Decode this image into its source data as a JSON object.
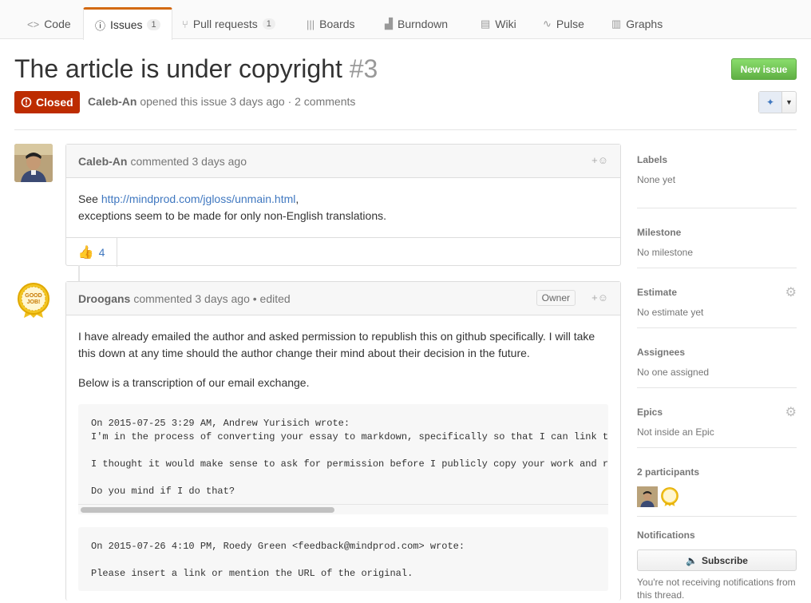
{
  "tabs": [
    {
      "icon": "<>",
      "label": "Code"
    },
    {
      "icon": "ⓘ",
      "label": "Issues",
      "count": "1"
    },
    {
      "icon": "⑂",
      "label": "Pull requests",
      "count": "1"
    },
    {
      "icon": "|||",
      "label": "Boards"
    },
    {
      "icon": "▟",
      "label": "Burndown"
    },
    {
      "icon": "▤",
      "label": "Wiki"
    },
    {
      "icon": "∿",
      "label": "Pulse"
    },
    {
      "icon": "▥",
      "label": "Graphs"
    }
  ],
  "issue": {
    "title": "The article is under copyright",
    "number": "#3",
    "state": "Closed",
    "author": "Caleb-An",
    "meta_rest": "opened this issue 3 days ago · 2 comments",
    "new_issue_label": "New issue"
  },
  "comments": [
    {
      "author": "Caleb-An",
      "action": "commented 3 days ago",
      "body_prefix": "See ",
      "link": "http://mindprod.com/jgloss/unmain.html",
      "body_suffix": ",",
      "body_line2": "exceptions seem to be made for only non-English translations.",
      "reaction_emoji": "👍",
      "reaction_count": "4",
      "react_icon": "+☺"
    },
    {
      "author": "Droogans",
      "action": "commented 3 days ago • edited",
      "owner_badge": "Owner",
      "react_icon": "+☺",
      "para1": "I have already emailed the author and asked permission to republish this on github specifically. I will take this down at any time should the author change their mind about their decision in the future.",
      "para2": "Below is a transcription of our email exchange.",
      "code1": "On 2015-07-25 3:29 AM, Andrew Yurisich wrote:\nI'm in the process of converting your essay to markdown, specifically so that I can link to\n\nI thought it would make sense to ask for permission before I publicly copy your work and re\n\nDo you mind if I do that?",
      "code2": "On 2015-07-26 4:10 PM, Roedy Green <feedback@mindprod.com> wrote:\n\nPlease insert a link or mention the URL of the original."
    }
  ],
  "sidebar": {
    "labels_h": "Labels",
    "labels_v": "None yet",
    "milestone_h": "Milestone",
    "milestone_v": "No milestone",
    "estimate_h": "Estimate",
    "estimate_v": "No estimate yet",
    "assignees_h": "Assignees",
    "assignees_v": "No one assigned",
    "epics_h": "Epics",
    "epics_v": "Not inside an Epic",
    "participants_h": "2 participants",
    "notifications_h": "Notifications",
    "subscribe_label": "Subscribe",
    "notif_text": "You're not receiving notifications from this thread."
  },
  "avatar2_text": "GOOD JOB!",
  "colors": {
    "accent": "#d26911",
    "closed": "#bd2c00",
    "new_issue": "#6cc644",
    "link": "#4078c0"
  }
}
